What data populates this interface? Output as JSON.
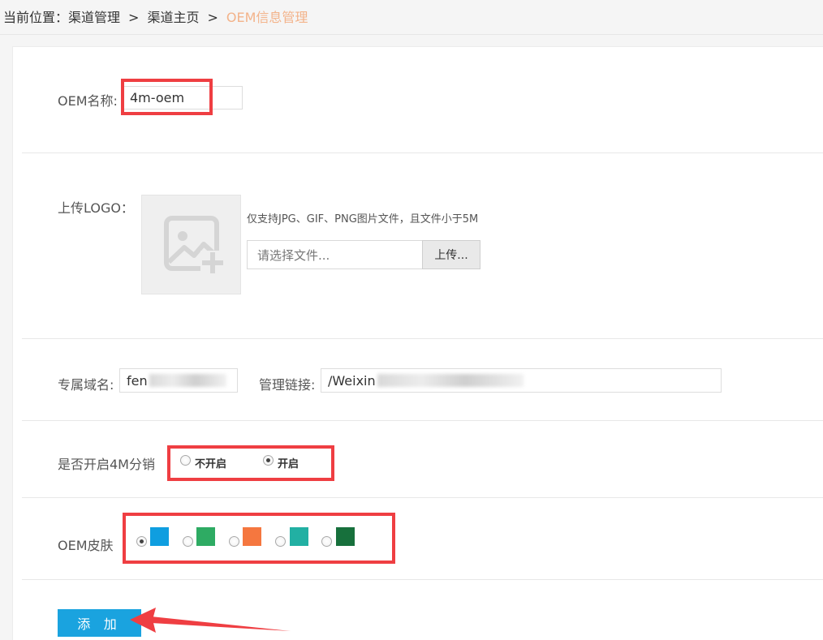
{
  "breadcrumb": {
    "prefix": "当前位置：",
    "item1": "渠道管理",
    "sep": ">",
    "item2": "渠道主页",
    "current": "OEM信息管理"
  },
  "form": {
    "oem_name": {
      "label": "OEM名称:",
      "value": "4m-oem"
    },
    "logo": {
      "label": "上传LOGO：",
      "hint": "仅支持JPG、GIF、PNG图片文件，且文件小于5M",
      "file_placeholder": "请选择文件...",
      "upload_label": "上传..."
    },
    "domain": {
      "label": "专属域名:",
      "value": "fen"
    },
    "admin_link": {
      "label": "管理链接:",
      "value": "/Weixin"
    },
    "distribution": {
      "label": "是否开启4M分销",
      "options": [
        "不开启",
        "开启"
      ],
      "selected": "开启"
    },
    "skin": {
      "label": "OEM皮肤",
      "colors": [
        "#0f9ee0",
        "#2eab63",
        "#f5773f",
        "#22b0a3",
        "#17703c"
      ],
      "selected_index": 0
    },
    "submit_label": "添 加"
  },
  "colors": {
    "accent": "#1aa3df",
    "highlight": "#ef3e42",
    "breadcrumb_current": "#f3b38a"
  }
}
